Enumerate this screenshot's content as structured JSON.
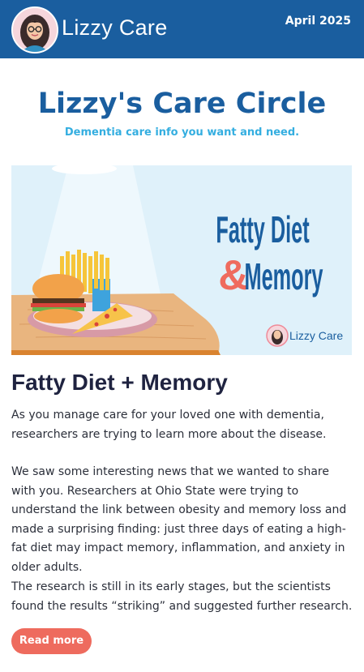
{
  "header": {
    "brand": "Lizzy Care",
    "date": "April 2025",
    "header_bg": "#1a5e9f"
  },
  "newsletter": {
    "title": "Lizzy's Care Circle",
    "subtitle": "Dementia care info you want and need."
  },
  "hero": {
    "headline_line1": "Fatty Diet",
    "headline_amp": "&",
    "headline_line2": "Memory",
    "logo_text": "Lizzy Care",
    "icon": "burger-fries-pizza-plate"
  },
  "article": {
    "title": "Fatty Diet + Memory",
    "paragraphs": [
      "As you manage care for your loved one with dementia, researchers are trying to learn more about the disease.",
      "We saw some interesting news that we wanted to share with you. Researchers at Ohio State were trying to understand the link between obesity and memory loss and made a surprising finding: just three days of eating a high-fat diet may impact memory, inflammation, and anxiety in older adults.",
      "The research is still in its early stages, but the scientists found the results “striking” and suggested further research."
    ],
    "button_label": "Read more",
    "accent": "#ee6b5e"
  }
}
